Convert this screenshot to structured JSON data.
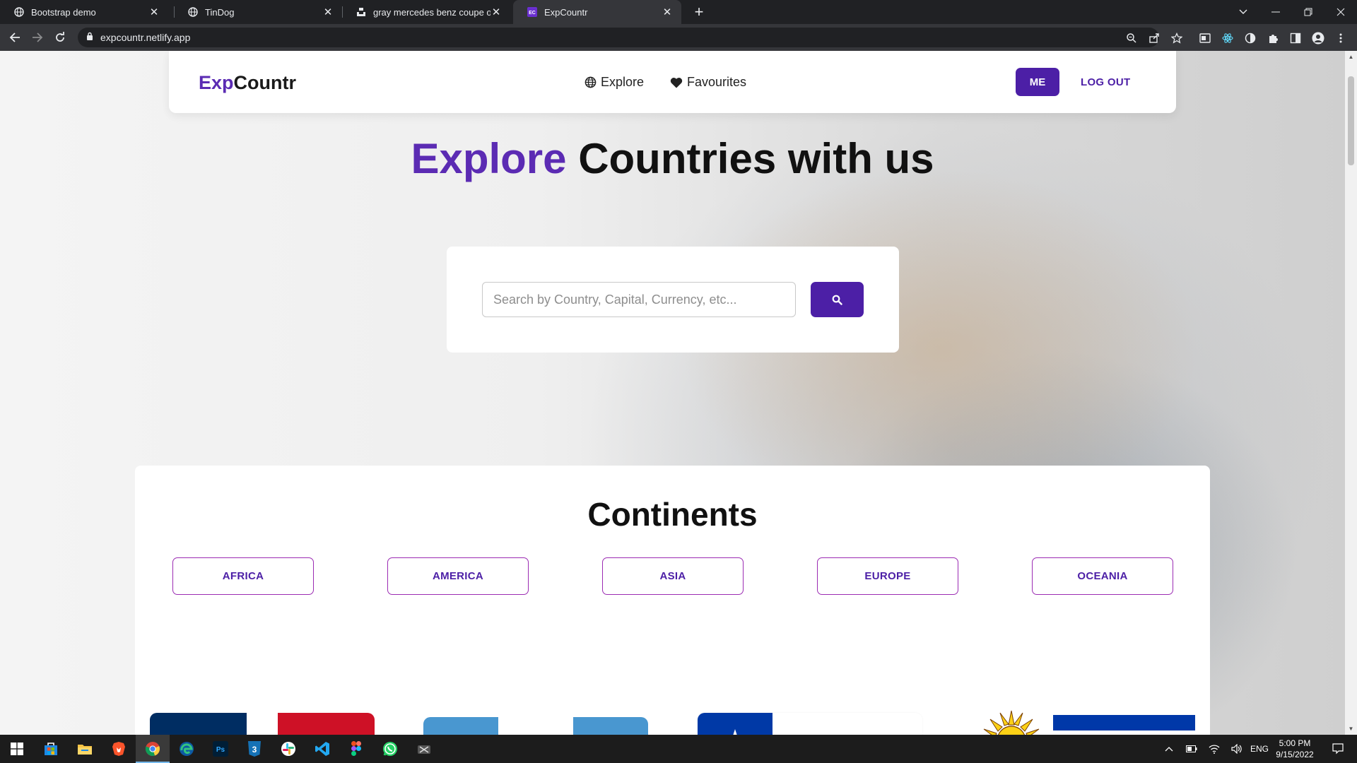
{
  "browser": {
    "tabs": [
      {
        "title": "Bootstrap demo",
        "icon": "globe-icon"
      },
      {
        "title": "TinDog",
        "icon": "globe-icon"
      },
      {
        "title": "gray mercedes benz coupe on bl",
        "icon": "unsplash-icon"
      },
      {
        "title": "ExpCountr",
        "icon": "expcountr-favicon",
        "active": true
      }
    ],
    "url": "expcountr.netlify.app"
  },
  "nav": {
    "logo_part1": "Exp",
    "logo_part2": "Countr",
    "explore_label": "Explore",
    "favourites_label": "Favourites",
    "me_label": "ME",
    "logout_label": "LOG OUT"
  },
  "hero": {
    "accent_word": "Explore",
    "rest": "Countries with us"
  },
  "search": {
    "placeholder": "Search by Country, Capital, Currency, etc..."
  },
  "continents": {
    "title": "Continents",
    "items": [
      "AFRICA",
      "AMERICA",
      "ASIA",
      "EUROPE",
      "OCEANIA"
    ]
  },
  "flags": [
    "dominican-republic-flag",
    "guatemala-flag",
    "chile-flag",
    "uruguay-flag"
  ],
  "taskbar": {
    "language": "ENG",
    "time": "5:00 PM",
    "date": "9/15/2022"
  },
  "colors": {
    "accent": "#5b2bb3",
    "button": "#4c1fa6",
    "outline": "#9b2bb3"
  }
}
